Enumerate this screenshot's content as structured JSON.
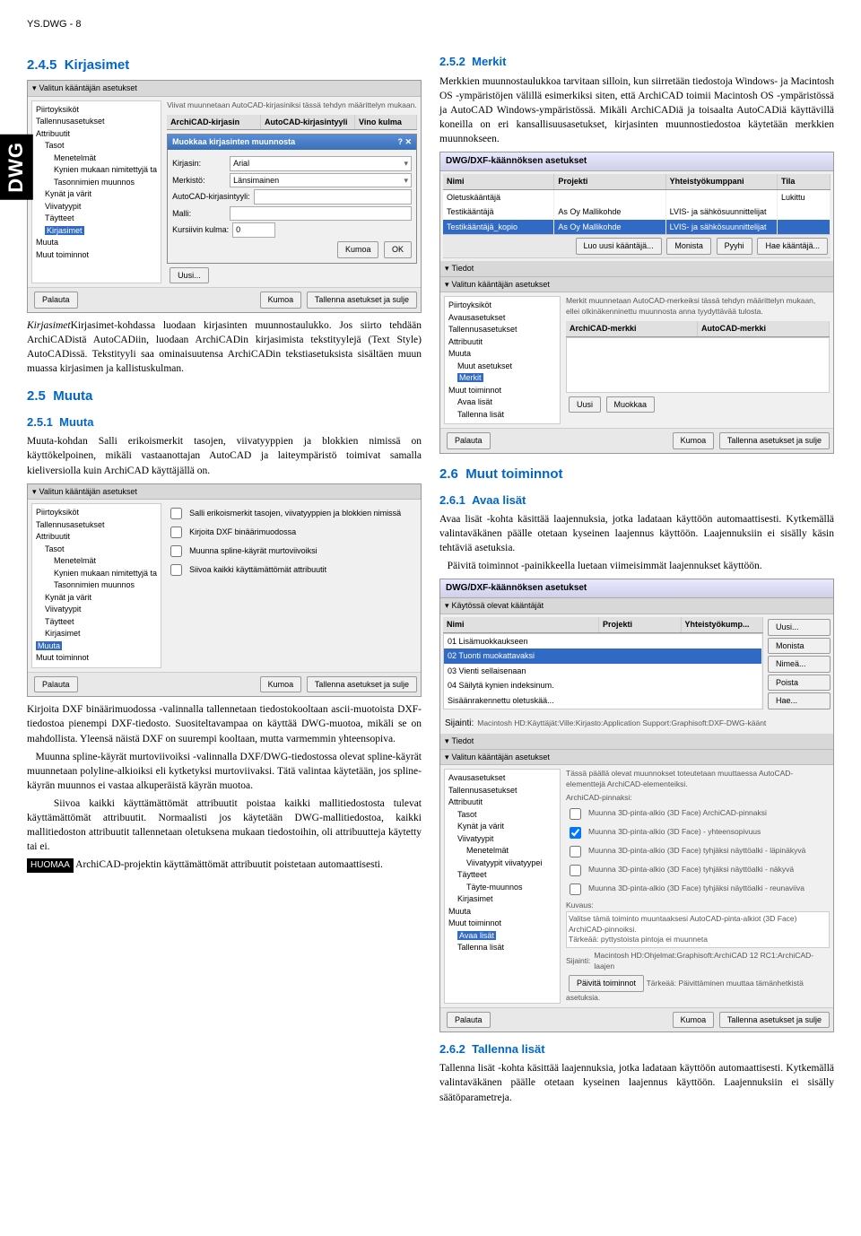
{
  "header": "YS.DWG - 8",
  "sidebar_tab": "DWG",
  "sections": {
    "s245": {
      "num": "2.4.5",
      "title": "Kirjasimet"
    },
    "s25": {
      "num": "2.5",
      "title": "Muuta"
    },
    "s251": {
      "num": "2.5.1",
      "title": "Muuta"
    },
    "s252": {
      "num": "2.5.2",
      "title": "Merkit"
    },
    "s26": {
      "num": "2.6",
      "title": "Muut toiminnot"
    },
    "s261": {
      "num": "2.6.1",
      "title": "Avaa lisät"
    },
    "s262": {
      "num": "2.6.2",
      "title": "Tallenna lisät"
    }
  },
  "paragraphs": {
    "p_kirjasimet": "Kirjasimet-kohdassa luodaan kirjasinten muunnostaulukko. Jos siirto tehdään ArchiCADistä AutoCADiin, luodaan ArchiCADin kirjasimista tekstityylejä (Text Style) AutoCADissä. Tekstityyli saa ominaisuutensa ArchiCADin tekstiasetuksista sisältäen muun muassa kirjasimen ja kallistuskulman.",
    "p_muuta": "Muuta-kohdan Salli erikoismerkit tasojen, viivatyyppien ja blokkien nimissä on käyttökelpoinen, mikäli vastaanottajan AutoCAD ja laiteympäristö toimivat samalla kieliversiolla kuin ArchiCAD käyttäjällä on.",
    "p_kirjoita": "Kirjoita DXF binäärimuodossa -valinnalla tallennetaan tiedostokooltaan ascii-muotoista DXF-tiedostoa pienempi DXF-tiedosto. Suositeltavampaa on käyttää DWG-muotoa, mikäli se on mahdollista. Yleensä näistä DXF on suurempi kooltaan, mutta varmemmin yhteensopiva.",
    "p_muunna": "Muunna spline-käyrät murtoviivoiksi -valinnalla DXF/DWG-tiedostossa olevat spline-käyrät muunnetaan polyline-alkioiksi eli kytketyksi murtoviivaksi. Tätä valintaa käytetään, jos spline-käyrän muunnos ei vastaa alkuperäistä käyrän muotoa.",
    "p_siivoa": "Siivoa kaikki käyttämättömät attribuutit poistaa kaikki mallitiedostosta tulevat käyttämättömät attribuutit. Normaalisti jos käytetään DWG-mallitiedostoa, kaikki mallitiedoston attribuutit tallennetaan oletuksena mukaan tiedostoihin, oli attribuutteja käytetty tai ei.",
    "p_huomaa": "ArchiCAD-projektin käyttämättömät attribuutit poistetaan automaattisesti.",
    "p_merkit": "Merkkien muunnostaulukkoa tarvitaan silloin, kun siirretään tiedostoja Windows- ja Macintosh OS -ympäristöjen välillä esimerkiksi siten, että ArchiCAD toimii Macintosh OS -ympäristössä ja AutoCAD Windows-ympäristössä. Mikäli ArchiCADiä ja toisaalta AutoCADiä käyttävillä koneilla on eri kansallisuusasetukset, kirjasinten muunnostiedostoa käytetään merkkien muunnokseen.",
    "p_avaa": "Avaa lisät -kohta käsittää laajennuksia, jotka ladataan käyttöön automaattisesti. Kytkemällä valintaväkänen päälle otetaan kyseinen laajennus käyttöön. Laajennuksiin ei sisälly käsin tehtäviä asetuksia.",
    "p_paivita": "Päivitä toiminnot -painikkeella luetaan viimeisimmät laajennukset käyttöön.",
    "p_tallenna": "Tallenna lisät -kohta käsittää laajennuksia, jotka ladataan käyttöön automaattisesti. Kytkemällä valintaväkänen päälle otetaan kyseinen laajennus käyttöön. Laajennuksiin ei sisälly säätöparametreja."
  },
  "labels": {
    "huomaa": "HUOMAA"
  },
  "fig1": {
    "section_header": "Valitun kääntäjän asetukset",
    "tree": [
      "Piirtoyksiköt",
      "Tallennusasetukset",
      "Attribuutit",
      "Tasot",
      "Menetelmät",
      "Kynien mukaan nimitettyjä ta",
      "Tasonnimien muunnos",
      "Kynät ja värit",
      "Viivatyypit",
      "Täytteet",
      "Kirjasimet",
      "Muuta",
      "Muut toiminnot"
    ],
    "tree_selected": "Kirjasimet",
    "desc": "Viivat muunnetaan AutoCAD-kirjasiniksi tässä tehdyn määrittelyn mukaan.",
    "cols": [
      "ArchiCAD-kirjasin",
      "AutoCAD-kirjasintyyli",
      "Vino kulma"
    ],
    "dialog_title": "Muokkaa kirjasinten muunnosta",
    "fields": {
      "kirjasin": "Kirjasin:",
      "kirjasin_val": "Arial",
      "merkisto": "Merkistö:",
      "merkisto_val": "Länsimainen",
      "tyyli": "AutoCAD-kirjasintyyli:",
      "malli": "Malli:",
      "kursiivi": "Kursiivin kulma:",
      "kursiivi_val": "0"
    },
    "dialog_buttons": [
      "Kumoa",
      "OK"
    ],
    "footer_buttons": [
      "Uusi...",
      "Palauta",
      "Kumoa",
      "Tallenna asetukset ja sulje"
    ]
  },
  "fig2": {
    "section_header": "Valitun kääntäjän asetukset",
    "tree": [
      "Piirtoyksiköt",
      "Tallennusasetukset",
      "Attribuutit",
      "Tasot",
      "Menetelmät",
      "Kynien mukaan nimitettyjä ta",
      "Tasonnimien muunnos",
      "Kynät ja värit",
      "Viivatyypit",
      "Täytteet",
      "Kirjasimet",
      "Muuta",
      "Muut toiminnot"
    ],
    "tree_selected": "Muuta",
    "checks": [
      "Salli erikoismerkit tasojen, viivatyyppien ja blokkien nimissä",
      "Kirjoita DXF binäärimuodossa",
      "Muunna spline-käyrät murtoviivoiksi",
      "Siivoa kaikki käyttämättömät attribuutit"
    ],
    "footer_buttons": [
      "Palauta",
      "Kumoa",
      "Tallenna asetukset ja sulje"
    ]
  },
  "fig3": {
    "title": "DWG/DXF-käännöksen asetukset",
    "cols": [
      "Nimi",
      "Projekti",
      "Yhteistyökumppani",
      "Tila"
    ],
    "rows": [
      [
        "Oletuskääntäjä",
        "",
        "",
        "Lukittu"
      ],
      [
        "Testikääntäjä",
        "As Oy Mallikohde",
        "LVIS- ja sähkösuunnittelijat",
        ""
      ],
      [
        "Testikääntäjä_kopio",
        "As Oy Mallikohde",
        "LVIS- ja sähkösuunnittelijat",
        ""
      ]
    ],
    "midbtns": [
      "Luo uusi kääntäjä...",
      "Monista",
      "Pyyhi",
      "Hae kääntäjä..."
    ],
    "section1": "Tiedot",
    "section2": "Valitun kääntäjän asetukset",
    "tree": [
      "Piirtoyksiköt",
      "Avausasetukset",
      "Tallennusasetukset",
      "Attribuutit",
      "Muuta",
      "Muut asetukset",
      "Merkit",
      "Muut toiminnot",
      "Avaa lisät",
      "Tallenna lisät"
    ],
    "tree_selected": "Merkit",
    "desc": "Merkit muunnetaan AutoCAD-merkeiksi tässä tehdyn määrittelyn mukaan, ellei olkinäkenninettu muunnosta anna tyydyttävää tulosta.",
    "subcols": [
      "ArchiCAD-merkki",
      "AutoCAD-merkki"
    ],
    "footer_buttons": [
      "Uusi",
      "Muokkaa",
      "Palauta",
      "Kumoa",
      "Tallenna asetukset ja sulje"
    ]
  },
  "fig4": {
    "title": "DWG/DXF-käännöksen asetukset",
    "section1": "Käytössä olevat kääntäjät",
    "cols": [
      "Nimi",
      "Projekti",
      "Yhteistyökump..."
    ],
    "rows": [
      "01 Lisämuokkaukseen",
      "02 Tuonti muokattavaksi",
      "03 Vienti sellaisenaan",
      "04 Säilytä kynien indeksinum.",
      "Sisäänrakennettu oletuskää..."
    ],
    "sidebtns": [
      "Uusi...",
      "Monista",
      "Nimeä...",
      "Poista",
      "Hae..."
    ],
    "sijainti_label": "Sijainti:",
    "sijainti_val": "Macintosh HD:Käyttäjät:Ville:Kirjasto:Application Support:Graphisoft:DXF-DWG-käänt",
    "section2": "Tiedot",
    "section3": "Valitun kääntäjän asetukset",
    "tree": [
      "Avausasetukset",
      "Tallennusasetukset",
      "Attribuutit",
      "Tasot",
      "Kynät ja värit",
      "Viivatyypit",
      "Menetelmät",
      "Viivatyypit viivatyypei",
      "Täytteet",
      "Täyte-muunnos",
      "Kirjasimet",
      "Muuta",
      "Muut toiminnot",
      "Avaa lisät",
      "Tallenna lisät"
    ],
    "tree_selected": "Avaa lisät",
    "desc": "Tässä päällä olevat muunnokset toteutetaan muuttaessa AutoCAD-elementtejä ArchiCAD-elementeiksi.",
    "sub_label": "ArchiCAD-pinnaksi:",
    "checks": [
      "Muunna 3D-pinta-alkio (3D Face) ArchiCAD-pinnaksi",
      "Muunna 3D-pinta-alkio (3D Face) - yhteensopivuus",
      "Muunna 3D-pinta-alkio (3D Face) tyhjäksi näyttöalki - läpinäkyvä",
      "Muunna 3D-pinta-alkio (3D Face) tyhjäksi näyttöalki - näkyvä",
      "Muunna 3D-pinta-alkio (3D Face) tyhjäksi näyttöalki - reunaviiva"
    ],
    "kuvaus_label": "Kuvaus:",
    "kuvaus_text": "Valitse tämä toiminto muuntaaksesi AutoCAD-pinta-alkiot (3D Face) ArchiCAD-pinnoiksi.",
    "tarkeaa": "Tärkeää: pyttystoista pintoja ei muunneta",
    "sij2_label": "Sijainti:",
    "sij2_val": "Macintosh HD:Ohjelmat:Graphisoft:ArchiCAD 12 RC1:ArchiCAD-laajen",
    "bottom_btns": [
      "Päivitä toiminnot"
    ],
    "bottom_desc": "Tärkeää: Päivittäminen muuttaa tämänhetkistä asetuksia.",
    "footer_buttons": [
      "Palauta",
      "Kumoa",
      "Tallenna asetukset ja sulje"
    ]
  }
}
